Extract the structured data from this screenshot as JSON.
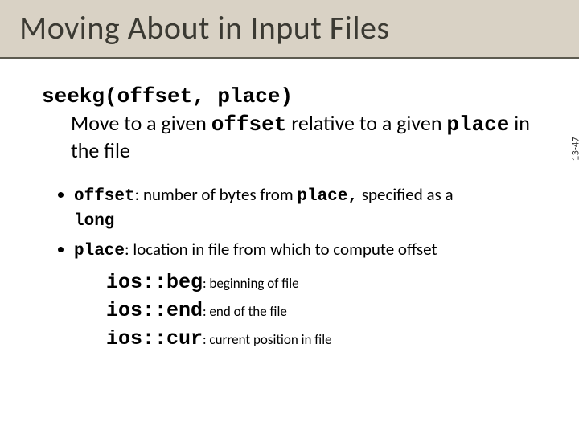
{
  "title": "Moving About in Input Files",
  "slide_number": "13-47",
  "seekg": {
    "signature": "seekg(offset, place)",
    "desc_pre": "Move to a given ",
    "desc_mid1": "offset",
    "desc_mid2": " relative to a given ",
    "desc_mid3": "place",
    "desc_post": " in the file"
  },
  "bullets": {
    "b1_a": "offset",
    "b1_b": ": number of bytes from ",
    "b1_c": "place,",
    "b1_d": " specified as a ",
    "b1_e": "long",
    "b2_a": "place",
    "b2_b": ": location in file from which to compute offset"
  },
  "flags": {
    "f1_code": "ios::beg",
    "f1_desc": ": beginning of file",
    "f2_code": "ios::end",
    "f2_desc": ": end of the file",
    "f3_code": "ios::cur",
    "f3_desc": ": current position in file"
  }
}
